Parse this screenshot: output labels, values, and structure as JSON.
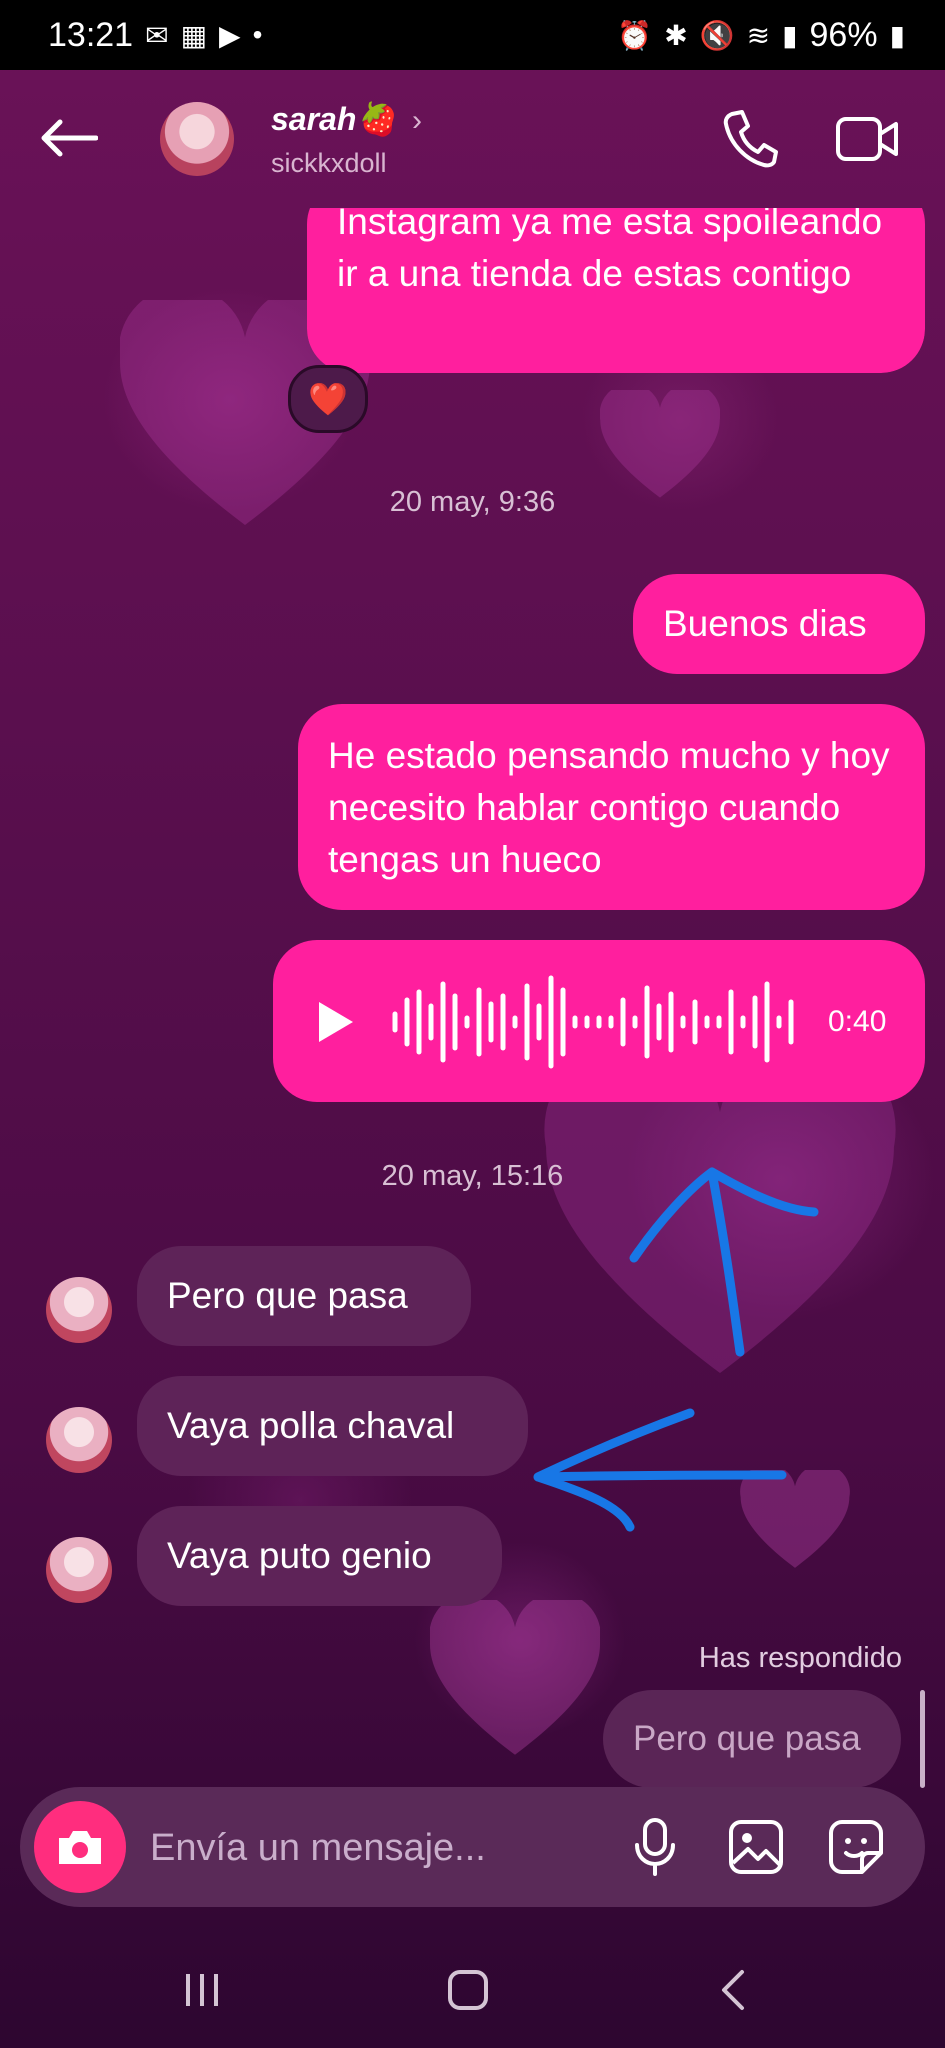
{
  "status_bar": {
    "time": "13:21",
    "battery": "96%"
  },
  "header": {
    "name": "sarah",
    "name_emoji": "🍓",
    "username": "sickkxdoll"
  },
  "messages": {
    "out_top": "Instagram ya me esta spoileando ir a una tienda de estas contigo",
    "reaction": "❤️",
    "timestamp_1": "20 may, 9:36",
    "out_1": "Buenos dias",
    "out_2": "He estado pensando mucho y hoy necesito hablar contigo cuando tengas un hueco",
    "voice_duration": "0:40",
    "timestamp_2": "20 may, 15:16",
    "in_1": "Pero que pasa",
    "in_2": "Vaya polla chaval",
    "in_3": "Vaya puto genio",
    "replied_label": "Has respondido",
    "replied_quote": "Pero que pasa"
  },
  "composer": {
    "placeholder": "Envía un mensaje..."
  },
  "colors": {
    "outgoing_bubble": "#ff1f9e",
    "incoming_bubble": "#5e2358",
    "annotation_arrow": "#1877e6"
  },
  "icons": [
    "back-arrow-icon",
    "chevron-right-icon",
    "phone-icon",
    "video-camera-icon",
    "play-icon",
    "camera-icon",
    "microphone-icon",
    "image-icon",
    "sticker-icon",
    "recents-icon",
    "home-icon",
    "back-nav-icon"
  ]
}
